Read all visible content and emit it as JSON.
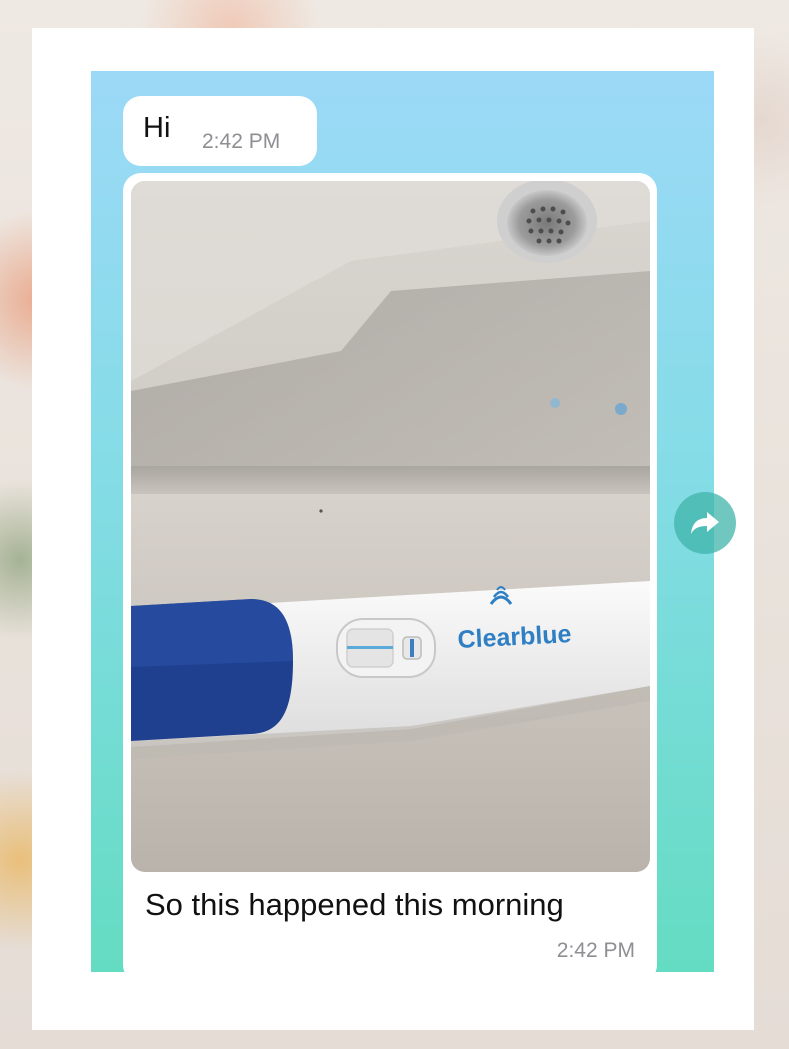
{
  "messages": [
    {
      "text": "Hi",
      "time": "2:42 PM"
    },
    {
      "type": "photo",
      "photo_text": "Clearblue",
      "caption": "So this happened this morning",
      "time": "2:42 PM"
    }
  ],
  "icons": {
    "forward": "forward-icon"
  },
  "colors": {
    "chat_background_top": "#9cd9f7",
    "chat_background_bottom": "#64dcc2",
    "bubble": "#ffffff",
    "timestamp": "#8e8e93",
    "brand_text": "#2f7fc4"
  }
}
